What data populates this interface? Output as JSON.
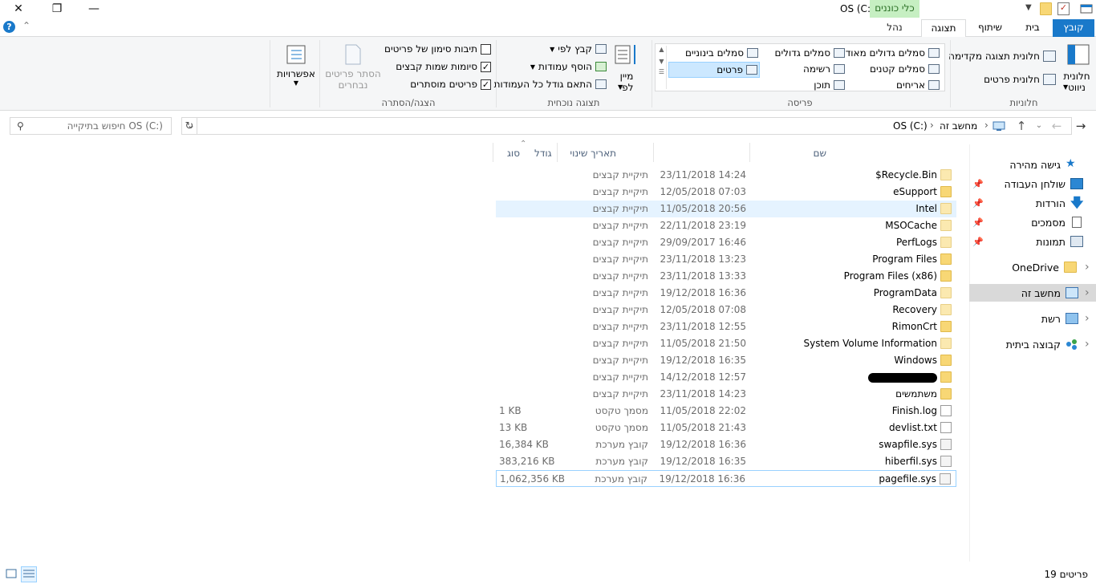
{
  "window": {
    "title": "OS (C:)",
    "contextual_tab": "כלי כוננים",
    "controls": {
      "close": "✕",
      "restore": "❐",
      "minimize": "—"
    }
  },
  "tabs": {
    "file": "קובץ",
    "home": "בית",
    "share": "שיתוף",
    "view": "תצוגה",
    "manage": "נהל"
  },
  "ribbon": {
    "panes": {
      "label": "חלוניות",
      "nav_pane": "חלונית ניווט",
      "preview_pane": "חלונית תצוגה מקדימה",
      "details_pane": "חלונית פרטים"
    },
    "layout": {
      "label": "פריסה",
      "extra_large": "סמלים גדולים מאוד",
      "large": "סמלים גדולים",
      "medium": "סמלים בינוניים",
      "small": "סמלים קטנים",
      "list": "רשימה",
      "details": "פרטים",
      "tiles": "אריחים",
      "content": "תוכן"
    },
    "current_view": {
      "label": "תצוגה נוכחית",
      "sort_by": "מיין לפי",
      "group_by": "קבץ לפי",
      "add_columns": "הוסף עמודות",
      "size_columns": "התאם גודל כל העמודות"
    },
    "show_hide": {
      "label": "הצגה/הסתרה",
      "item_checkboxes": "תיבות סימון של פריטים",
      "file_extensions": "סיומות שמות קבצים",
      "hidden_items": "פריטים מוסתרים",
      "hide_selected": "הסתר פריטים נבחרים",
      "item_checkboxes_checked": false,
      "file_extensions_checked": true,
      "hidden_items_checked": true
    },
    "options": "אפשרויות"
  },
  "address": {
    "path": [
      "מחשב זה",
      "OS (C:)"
    ],
    "search_placeholder": "חיפוש בתיקייה OS (C:)"
  },
  "nav": {
    "quick_access": "גישה מהירה",
    "desktop": "שולחן העבודה",
    "downloads": "הורדות",
    "documents": "מסמכים",
    "pictures": "תמונות",
    "onedrive": "OneDrive",
    "this_pc": "מחשב זה",
    "network": "רשת",
    "homegroup": "קבוצה ביתית"
  },
  "columns": {
    "name": "שם",
    "date": "תאריך שינוי",
    "type": "סוג",
    "size": "גודל"
  },
  "files": [
    {
      "name": "$Recycle.Bin",
      "date": "23/11/2018 14:24",
      "type": "תיקיית קבצים",
      "size": "",
      "kind": "folder-special"
    },
    {
      "name": "eSupport",
      "date": "12/05/2018 07:03",
      "type": "תיקיית קבצים",
      "size": "",
      "kind": "folder"
    },
    {
      "name": "Intel",
      "date": "11/05/2018 20:56",
      "type": "תיקיית קבצים",
      "size": "",
      "kind": "folder-special"
    },
    {
      "name": "MSOCache",
      "date": "22/11/2018 23:19",
      "type": "תיקיית קבצים",
      "size": "",
      "kind": "folder-special"
    },
    {
      "name": "PerfLogs",
      "date": "29/09/2017 16:46",
      "type": "תיקיית קבצים",
      "size": "",
      "kind": "folder-special"
    },
    {
      "name": "Program Files",
      "date": "23/11/2018 13:23",
      "type": "תיקיית קבצים",
      "size": "",
      "kind": "folder"
    },
    {
      "name": "Program Files (x86)",
      "date": "23/11/2018 13:33",
      "type": "תיקיית קבצים",
      "size": "",
      "kind": "folder"
    },
    {
      "name": "ProgramData",
      "date": "19/12/2018 16:36",
      "type": "תיקיית קבצים",
      "size": "",
      "kind": "folder-special"
    },
    {
      "name": "Recovery",
      "date": "12/05/2018 07:08",
      "type": "תיקיית קבצים",
      "size": "",
      "kind": "folder-special"
    },
    {
      "name": "RimonCrt",
      "date": "23/11/2018 12:55",
      "type": "תיקיית קבצים",
      "size": "",
      "kind": "folder"
    },
    {
      "name": "System Volume Information",
      "date": "11/05/2018 21:50",
      "type": "תיקיית קבצים",
      "size": "",
      "kind": "folder-special"
    },
    {
      "name": "Windows",
      "date": "19/12/2018 16:35",
      "type": "תיקיית קבצים",
      "size": "",
      "kind": "folder"
    },
    {
      "name": "",
      "date": "14/12/2018 12:57",
      "type": "תיקיית קבצים",
      "size": "",
      "kind": "folder",
      "redacted": true
    },
    {
      "name": "משתמשים",
      "date": "23/11/2018 14:23",
      "type": "תיקיית קבצים",
      "size": "",
      "kind": "folder"
    },
    {
      "name": "Finish.log",
      "date": "11/05/2018 22:02",
      "type": "מסמך טקסט",
      "size": "1 KB",
      "kind": "doc"
    },
    {
      "name": "devlist.txt",
      "date": "11/05/2018 21:43",
      "type": "מסמך טקסט",
      "size": "13 KB",
      "kind": "doc"
    },
    {
      "name": "swapfile.sys",
      "date": "19/12/2018 16:36",
      "type": "קובץ מערכת",
      "size": "16,384 KB",
      "kind": "sys"
    },
    {
      "name": "hiberfil.sys",
      "date": "19/12/2018 16:35",
      "type": "קובץ מערכת",
      "size": "383,216 KB",
      "kind": "sys"
    },
    {
      "name": "pagefile.sys",
      "date": "19/12/2018 16:36",
      "type": "קובץ מערכת",
      "size": "1,062,356 KB",
      "kind": "sys"
    }
  ],
  "status": {
    "count": "19 פריטים"
  },
  "colors": {
    "accent": "#1979ca",
    "selection": "#cce8ff",
    "hover": "#e5f3ff",
    "folder": "#f8d775",
    "contextual": "#c6efc2"
  }
}
